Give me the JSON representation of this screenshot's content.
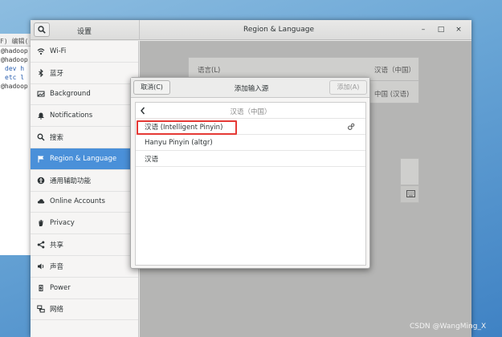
{
  "terminal": {
    "menu": "F)  编辑(",
    "lines": [
      "@hadoop",
      "@hadoop",
      "dev  h",
      "etc  l",
      "@hadoop"
    ]
  },
  "window": {
    "sidebar_title": "设置",
    "title": "Region & Language",
    "controls": {
      "minimize": "–",
      "maximize": "□",
      "close": "×"
    }
  },
  "sidebar": {
    "items": [
      {
        "label": "Wi-Fi",
        "icon": "wifi-icon"
      },
      {
        "label": "蓝牙",
        "icon": "bluetooth-icon"
      },
      {
        "label": "Background",
        "icon": "background-icon"
      },
      {
        "label": "Notifications",
        "icon": "bell-icon"
      },
      {
        "label": "搜索",
        "icon": "search-icon"
      },
      {
        "label": "Region & Language",
        "icon": "flag-icon",
        "active": true
      },
      {
        "label": "通用辅助功能",
        "icon": "accessibility-icon"
      },
      {
        "label": "Online Accounts",
        "icon": "cloud-icon"
      },
      {
        "label": "Privacy",
        "icon": "hand-icon"
      },
      {
        "label": "共享",
        "icon": "share-icon"
      },
      {
        "label": "声音",
        "icon": "speaker-icon"
      },
      {
        "label": "Power",
        "icon": "power-icon"
      },
      {
        "label": "网络",
        "icon": "network-icon"
      }
    ]
  },
  "region": {
    "language_label": "语言(L)",
    "language_value": "汉语（中国）",
    "formats_value": "中国 (汉语)"
  },
  "dialog": {
    "cancel_label": "取消(C)",
    "title": "添加输入源",
    "add_label": "添加(A)",
    "list_header": "汉语（中国）",
    "rows": [
      {
        "label": "汉语 (Intelligent Pinyin)",
        "has_settings": true,
        "highlighted": true
      },
      {
        "label": "Hanyu Pinyin (altgr)",
        "has_settings": false
      },
      {
        "label": "汉语",
        "has_settings": false
      }
    ]
  },
  "watermark": "CSDN @WangMing_X",
  "colors": {
    "accent": "#4a90d9",
    "highlight_box": "#e53935"
  }
}
